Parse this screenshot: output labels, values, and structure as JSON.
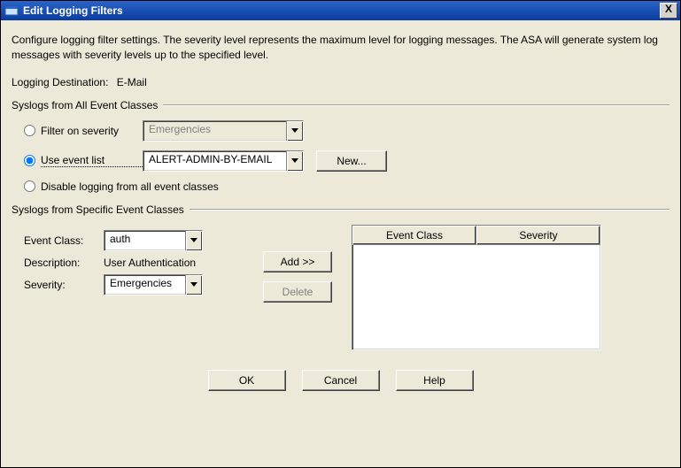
{
  "window": {
    "title": "Edit Logging Filters",
    "close_glyph": "X"
  },
  "description": "Configure logging filter settings. The severity level represents the maximum level for logging messages. The ASA will generate system log messages with severity levels up to the specified level.",
  "destination": {
    "label": "Logging Destination:",
    "value": "E-Mail"
  },
  "groupAll": {
    "title": "Syslogs from All Event Classes",
    "filterSeverity": {
      "label": "Filter on severity",
      "selected": "Emergencies"
    },
    "useEventList": {
      "label": "Use event list",
      "selected": "ALERT-ADMIN-BY-EMAIL",
      "newButton": "New..."
    },
    "disableAll": {
      "label": "Disable logging from all event classes"
    }
  },
  "groupSpecific": {
    "title": "Syslogs from Specific Event Classes",
    "eventClass": {
      "label": "Event Class:",
      "selected": "auth"
    },
    "description": {
      "label": "Description:",
      "value": "User Authentication"
    },
    "severity": {
      "label": "Severity:",
      "selected": "Emergencies"
    },
    "addButton": "Add >>",
    "deleteButton": "Delete",
    "table": {
      "headers": {
        "class": "Event Class",
        "severity": "Severity"
      }
    }
  },
  "buttons": {
    "ok": "OK",
    "cancel": "Cancel",
    "help": "Help"
  }
}
